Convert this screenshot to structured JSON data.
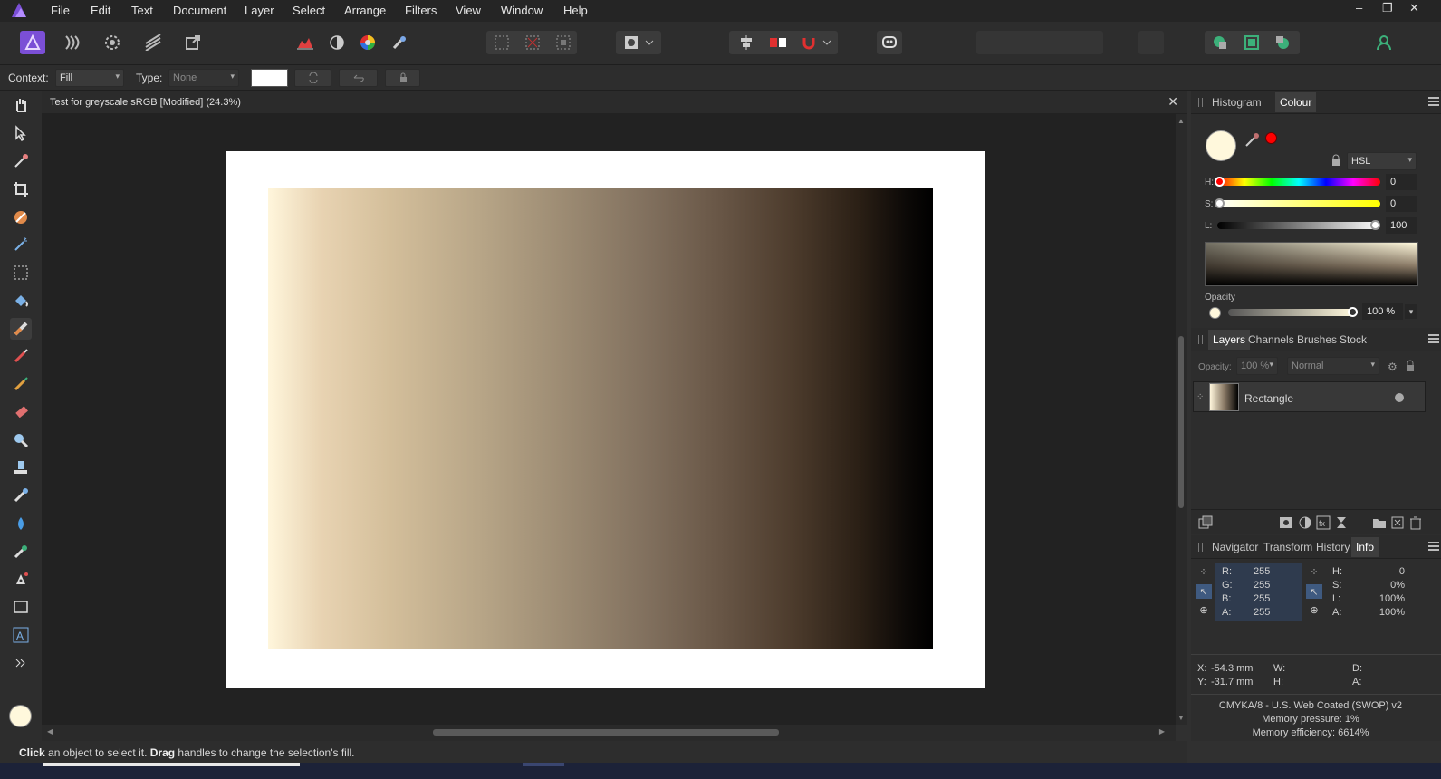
{
  "menu": {
    "items": [
      "File",
      "Edit",
      "Text",
      "Document",
      "Layer",
      "Select",
      "Arrange",
      "Filters",
      "View",
      "Window",
      "Help"
    ]
  },
  "window_controls": {
    "minimize": "–",
    "restore": "❐",
    "close": "✕"
  },
  "context_bar": {
    "context_label": "Context:",
    "context_value": "Fill",
    "type_label": "Type:",
    "type_value": "None"
  },
  "document": {
    "title": "Test for greyscale sRGB [Modified] (24.3%)",
    "close": "✕"
  },
  "colour_panel": {
    "tabs": [
      "Histogram",
      "Colour"
    ],
    "active_tab": "Colour",
    "model": "HSL",
    "h_label": "H:",
    "h_value": "0",
    "s_label": "S:",
    "s_value": "0",
    "l_label": "L:",
    "l_value": "100",
    "opacity_label": "Opacity",
    "opacity_value": "100 %",
    "primary_color": "#fff8dc",
    "secondary_color": "#ff0000"
  },
  "layers_panel": {
    "tabs": [
      "Layers",
      "Channels",
      "Brushes",
      "Stock"
    ],
    "active_tab": "Layers",
    "opacity_label": "Opacity:",
    "opacity_value": "100 %",
    "blend_mode": "Normal",
    "layers": [
      {
        "name": "Rectangle"
      }
    ]
  },
  "info_panel": {
    "tabs": [
      "Navigator",
      "Transform",
      "History",
      "Info"
    ],
    "active_tab": "Info",
    "rgb": [
      {
        "label": "R:",
        "value": "255"
      },
      {
        "label": "G:",
        "value": "255"
      },
      {
        "label": "B:",
        "value": "255"
      },
      {
        "label": "A:",
        "value": "255"
      }
    ],
    "hsl": [
      {
        "label": "H:",
        "value": "0"
      },
      {
        "label": "S:",
        "value": "0%"
      },
      {
        "label": "L:",
        "value": "100%"
      },
      {
        "label": "A:",
        "value": "100%"
      }
    ],
    "x_label": "X:",
    "x_value": "-54.3 mm",
    "y_label": "Y:",
    "y_value": "-31.7 mm",
    "w_label": "W:",
    "h_label": "H:",
    "d_label": "D:",
    "a_label": "A:",
    "profile": "CMYKA/8 - U.S. Web Coated (SWOP) v2",
    "memory_pressure": "Memory pressure: 1%",
    "memory_efficiency": "Memory efficiency: 6614%"
  },
  "status": {
    "click_word": "Click",
    "text1": " an object to select it. ",
    "drag_word": "Drag",
    "text2": " handles to change the selection's fill."
  },
  "colors": {
    "accent": "#7b4fd6",
    "canvas_bg": "#222222",
    "panel_bg": "#2d2d2d"
  }
}
